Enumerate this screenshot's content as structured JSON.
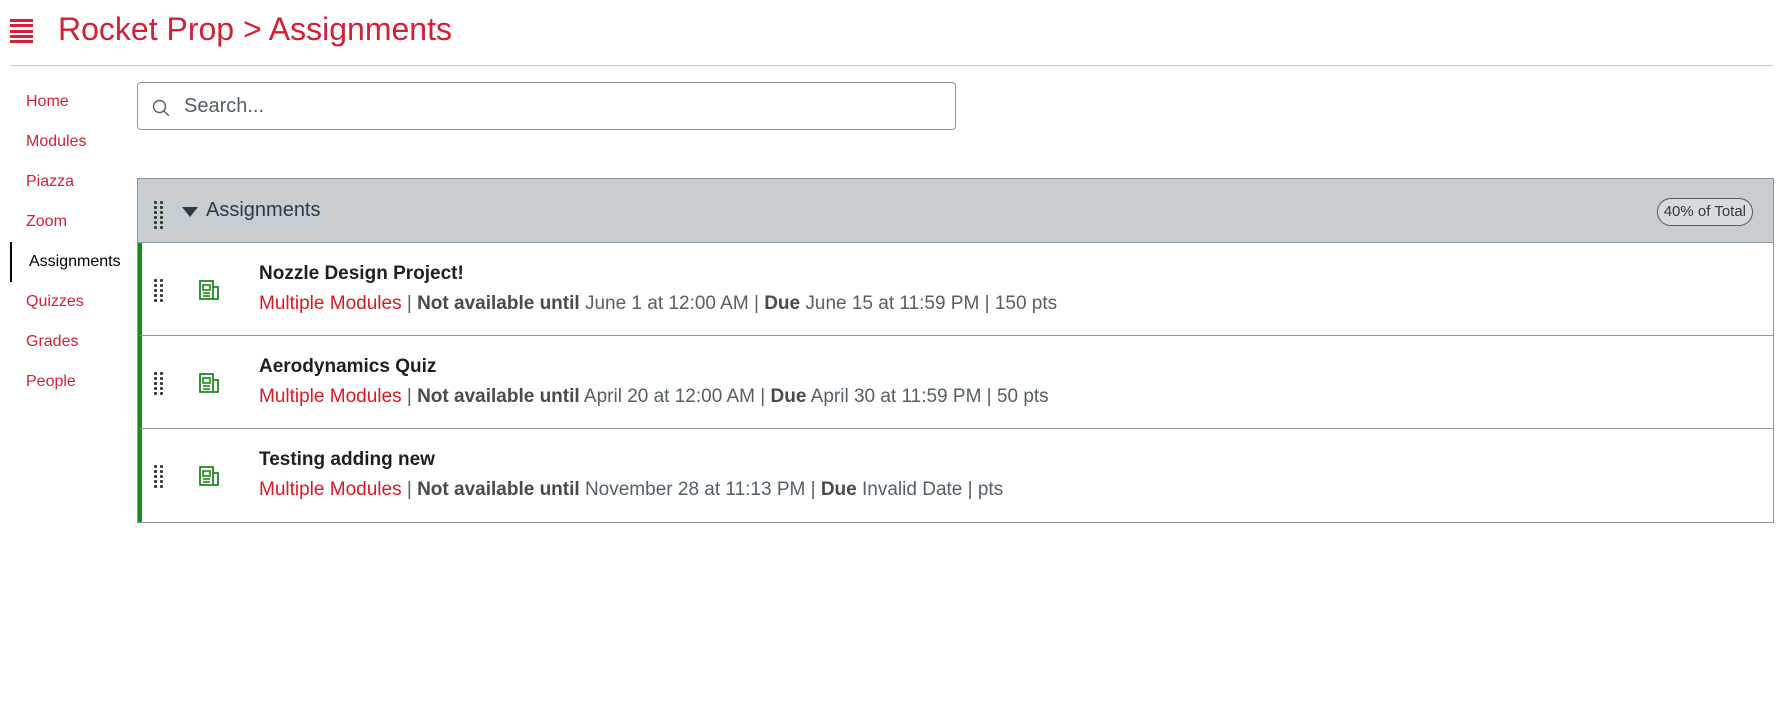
{
  "header": {
    "title": "Rocket Prop > Assignments"
  },
  "nav": {
    "items": [
      {
        "label": "Home"
      },
      {
        "label": "Modules"
      },
      {
        "label": "Piazza"
      },
      {
        "label": "Zoom"
      },
      {
        "label": "Assignments",
        "active": true
      },
      {
        "label": "Quizzes"
      },
      {
        "label": "Grades"
      },
      {
        "label": "People"
      }
    ]
  },
  "search": {
    "placeholder": "Search..."
  },
  "group": {
    "title": "Assignments",
    "weight": "40% of Total",
    "assignments": [
      {
        "title": "Nozzle Design Project!",
        "modules": "Multiple Modules",
        "available_label": "Not available until",
        "available": "June 1 at 12:00 AM",
        "due_label": "Due",
        "due": "June 15 at 11:59 PM",
        "points": "150 pts"
      },
      {
        "title": "Aerodynamics Quiz",
        "modules": "Multiple Modules",
        "available_label": "Not available until",
        "available": "April 20 at 12:00 AM",
        "due_label": "Due",
        "due": "April 30 at 11:59 PM",
        "points": "50 pts"
      },
      {
        "title": "Testing adding new",
        "modules": "Multiple Modules",
        "available_label": "Not available until",
        "available": "November 28 at 11:13 PM",
        "due_label": "Due",
        "due": "Invalid Date",
        "points": "pts"
      }
    ]
  },
  "colors": {
    "brand": "#d51f35",
    "module_link": "#e0161f",
    "assignment_icon": "#1b8a1b",
    "group_header_bg": "#c7cdd1"
  },
  "icons": {
    "menu": "hamburger-icon",
    "search": "search-icon",
    "drag": "drag-handle-icon",
    "collapse": "caret-down-icon",
    "assignment": "assignment-icon"
  }
}
